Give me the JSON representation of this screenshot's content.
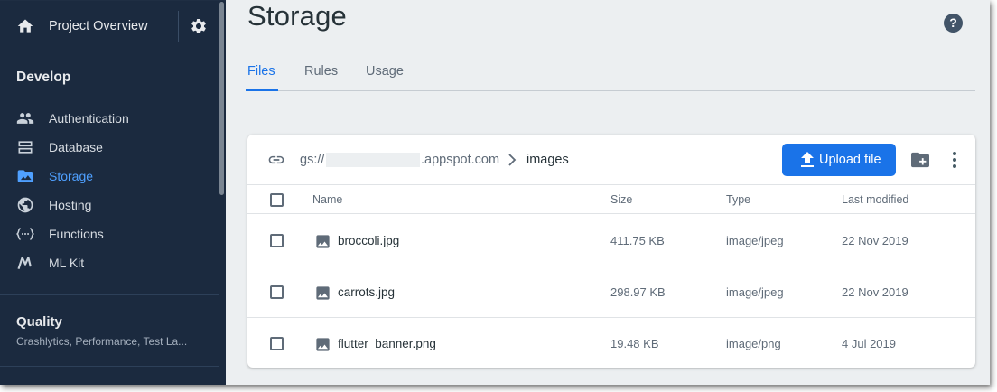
{
  "sidebar": {
    "project_title": "Project Overview",
    "develop_label": "Develop",
    "items": [
      {
        "label": "Authentication",
        "icon": "people-icon"
      },
      {
        "label": "Database",
        "icon": "database-icon"
      },
      {
        "label": "Storage",
        "icon": "storage-icon",
        "active": true
      },
      {
        "label": "Hosting",
        "icon": "globe-icon"
      },
      {
        "label": "Functions",
        "icon": "functions-icon"
      },
      {
        "label": "ML Kit",
        "icon": "mlkit-icon"
      }
    ],
    "quality_label": "Quality",
    "quality_sub": "Crashlytics, Performance, Test La..."
  },
  "page": {
    "title": "Storage",
    "help": "?"
  },
  "tabs": [
    {
      "label": "Files",
      "active": true
    },
    {
      "label": "Rules"
    },
    {
      "label": "Usage"
    }
  ],
  "toolbar": {
    "path_prefix": "gs://",
    "path_suffix": ".appspot.com",
    "folder": "images",
    "upload_label": "Upload file"
  },
  "table": {
    "columns": [
      "Name",
      "Size",
      "Type",
      "Last modified"
    ],
    "rows": [
      {
        "name": "broccoli.jpg",
        "size": "411.75 KB",
        "type": "image/jpeg",
        "modified": "22 Nov 2019"
      },
      {
        "name": "carrots.jpg",
        "size": "298.97 KB",
        "type": "image/jpeg",
        "modified": "22 Nov 2019"
      },
      {
        "name": "flutter_banner.png",
        "size": "19.48 KB",
        "type": "image/png",
        "modified": "4 Jul 2019"
      }
    ]
  },
  "colors": {
    "sidebar_bg": "#1b2a3f",
    "accent": "#1a73e8",
    "active_nav": "#4fa0ff"
  }
}
